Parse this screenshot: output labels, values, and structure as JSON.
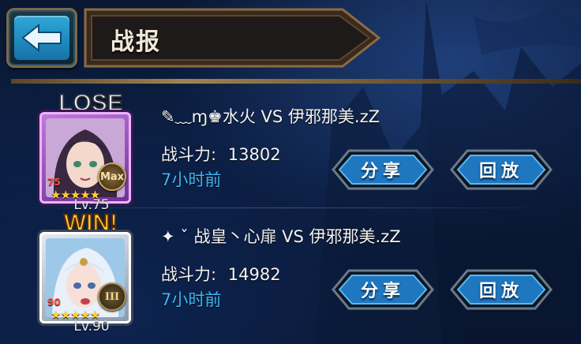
{
  "header": {
    "title": "战报"
  },
  "battles": [
    {
      "result": "LOSE",
      "level_label": "Lv.75",
      "star_level": "75",
      "badge": "Max",
      "stars": "★★★★★",
      "match": "✎﹏ɱ♚水火 VS 伊邪那美.zZ",
      "power_label": "战斗力:",
      "power_value": "13802",
      "time": "7小时前",
      "share_label": "分享",
      "replay_label": "回放"
    },
    {
      "result": "WIN!",
      "level_label": "Lv.90",
      "star_level": "90",
      "badge": "III",
      "stars": "★★★★★",
      "match": "✦ ˇ 战皇丶心扉 VS 伊邪那美.zZ",
      "power_label": "战斗力:",
      "power_value": "14982",
      "time": "7小时前",
      "share_label": "分享",
      "replay_label": "回放"
    }
  ],
  "colors": {
    "time_text": "#3bb7ef",
    "button_blue": "#1f77c0",
    "lose_frame": "#8a3ab8",
    "win_text": "#ffd23a"
  }
}
